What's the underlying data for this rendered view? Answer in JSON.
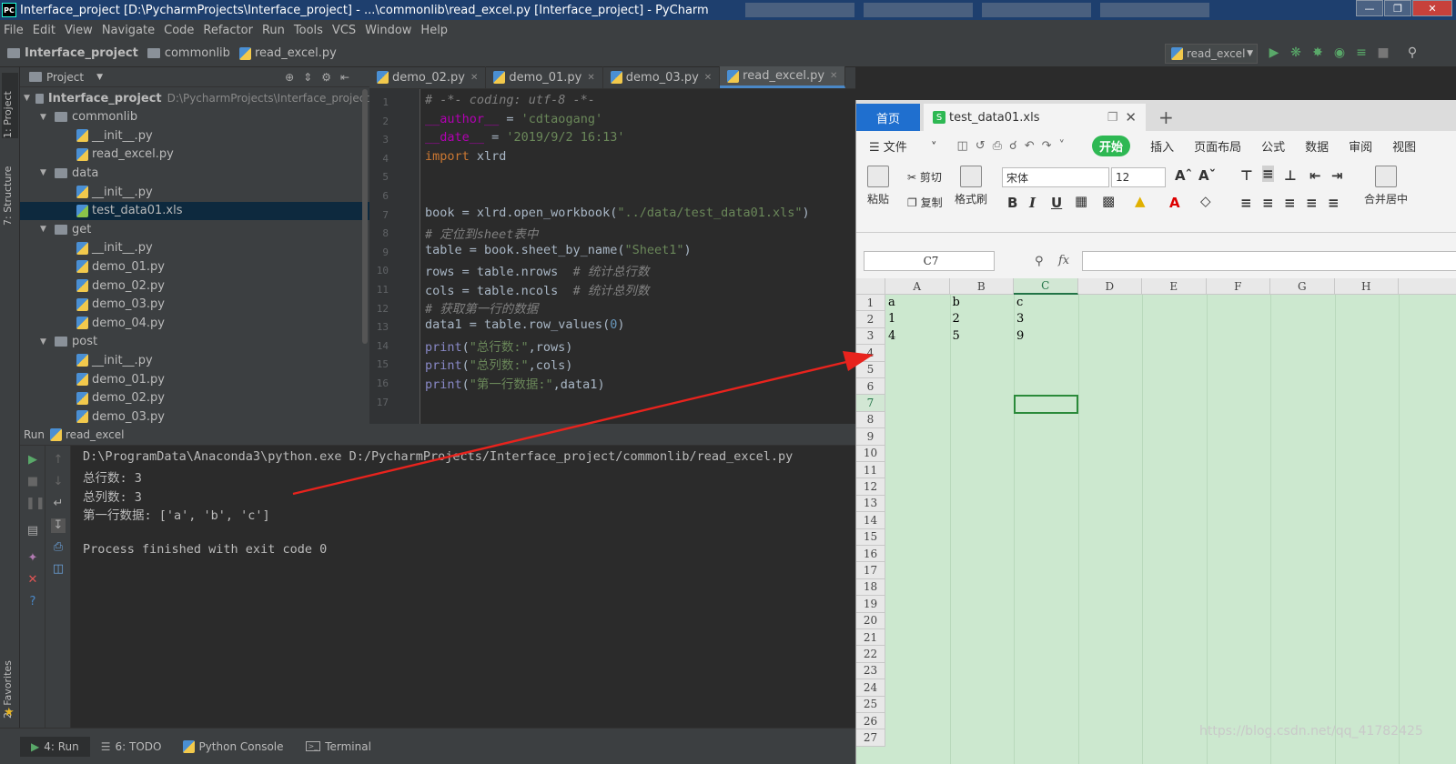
{
  "window": {
    "title": "Interface_project [D:\\PycharmProjects\\Interface_project] - ...\\commonlib\\read_excel.py [Interface_project] - PyCharm",
    "app_badge": "PC"
  },
  "menu": [
    "File",
    "Edit",
    "View",
    "Navigate",
    "Code",
    "Refactor",
    "Run",
    "Tools",
    "VCS",
    "Window",
    "Help"
  ],
  "breadcrumb": [
    "Interface_project",
    "commonlib",
    "read_excel.py"
  ],
  "run_config": "read_excel",
  "left_tabs": {
    "project": "1: Project",
    "structure": "7: Structure",
    "favorites": "2: Favorites"
  },
  "project_panel": {
    "title": "Project",
    "root": {
      "name": "Interface_project",
      "path": "D:\\PycharmProjects\\Interface_project"
    },
    "tree": [
      {
        "label": "commonlib",
        "type": "folder",
        "level": 1
      },
      {
        "label": "__init__.py",
        "type": "py",
        "level": 2
      },
      {
        "label": "read_excel.py",
        "type": "py",
        "level": 2
      },
      {
        "label": "data",
        "type": "folder",
        "level": 1
      },
      {
        "label": "__init__.py",
        "type": "py",
        "level": 2
      },
      {
        "label": "test_data01.xls",
        "type": "xls",
        "level": 2,
        "selected": true
      },
      {
        "label": "get",
        "type": "folder",
        "level": 1
      },
      {
        "label": "__init__.py",
        "type": "py",
        "level": 2
      },
      {
        "label": "demo_01.py",
        "type": "py",
        "level": 2
      },
      {
        "label": "demo_02.py",
        "type": "py",
        "level": 2
      },
      {
        "label": "demo_03.py",
        "type": "py",
        "level": 2
      },
      {
        "label": "demo_04.py",
        "type": "py",
        "level": 2
      },
      {
        "label": "post",
        "type": "folder",
        "level": 1
      },
      {
        "label": "__init__.py",
        "type": "py",
        "level": 2
      },
      {
        "label": "demo_01.py",
        "type": "py",
        "level": 2
      },
      {
        "label": "demo_02.py",
        "type": "py",
        "level": 2
      },
      {
        "label": "demo_03.py",
        "type": "py",
        "level": 2
      }
    ]
  },
  "editor_tabs": [
    "demo_02.py",
    "demo_01.py",
    "demo_03.py",
    "read_excel.py"
  ],
  "code": {
    "line_numbers": [
      "1",
      "2",
      "3",
      "4",
      "5",
      "6",
      "7",
      "8",
      "9",
      "10",
      "11",
      "12",
      "13",
      "14",
      "15",
      "16",
      "17"
    ],
    "l1": "# -*- coding: utf-8 -*-",
    "l2a": "__author__",
    "l2b": " = ",
    "l2c": "'cdtaogang'",
    "l3a": "__date__",
    "l3b": " = ",
    "l3c": "'2019/9/2 16:13'",
    "l4a": "import",
    "l4b": " xlrd",
    "l7a": "book = xlrd.open_workbook(",
    "l7b": "\"../data/test_data01.xls\"",
    "l7c": ")",
    "l8": "# 定位到sheet表中",
    "l9a": "table = book.sheet_by_name(",
    "l9b": "\"Sheet1\"",
    "l9c": ")",
    "l10a": "rows = table.nrows  ",
    "l10b": "# 统计总行数",
    "l11a": "cols = table.ncols  ",
    "l11b": "# 统计总列数",
    "l12": "# 获取第一行的数据",
    "l13a": "data1 = table.row_values(",
    "l13b": "0",
    "l13c": ")",
    "l14a": "print",
    "l14b": "(",
    "l14c": "\"总行数:\"",
    "l14d": ",rows)",
    "l15a": "print",
    "l15b": "(",
    "l15c": "\"总列数:\"",
    "l15d": ",cols)",
    "l16a": "print",
    "l16b": "(",
    "l16c": "\"第一行数据:\"",
    "l16d": ",data1)"
  },
  "run": {
    "label": "Run",
    "config": "read_excel",
    "output": [
      "D:\\ProgramData\\Anaconda3\\python.exe D:/PycharmProjects/Interface_project/commonlib/read_excel.py",
      "总行数: 3",
      "总列数: 3",
      "第一行数据: ['a', 'b', 'c']",
      "",
      "Process finished with exit code 0"
    ]
  },
  "bottom_tabs": [
    "4: Run",
    "6: TODO",
    "Python Console",
    "Terminal"
  ],
  "wps": {
    "home_tab": "首页",
    "file_tab": "test_data01.xls",
    "menu": [
      "文件",
      "开始",
      "插入",
      "页面布局",
      "公式",
      "数据",
      "审阅",
      "视图"
    ],
    "ribbon": {
      "paste": "粘贴",
      "cut": "剪切",
      "copy": "复制",
      "format_painter": "格式刷",
      "font": "宋体",
      "size": "12",
      "merge": "合并居中"
    },
    "cell_ref": "C7",
    "fx": "fx",
    "columns": [
      "A",
      "B",
      "C",
      "D",
      "E",
      "F",
      "G",
      "H"
    ],
    "rows": [
      "1",
      "2",
      "3",
      "4",
      "5",
      "6",
      "7",
      "8",
      "9",
      "10",
      "11",
      "12",
      "13",
      "14",
      "15",
      "16",
      "17",
      "18",
      "19",
      "20",
      "21",
      "22",
      "23",
      "24",
      "25",
      "26",
      "27"
    ],
    "cells": [
      [
        "a",
        "b",
        "c"
      ],
      [
        "1",
        "2",
        "3"
      ],
      [
        "4",
        "5",
        "9"
      ]
    ]
  },
  "watermark": "https://blog.csdn.net/qq_41782425",
  "colors": {
    "accent": "#4a88c7",
    "wps_green": "#2eb853",
    "arrow": "#e8231d",
    "grid_bg": "#cce8cf"
  }
}
